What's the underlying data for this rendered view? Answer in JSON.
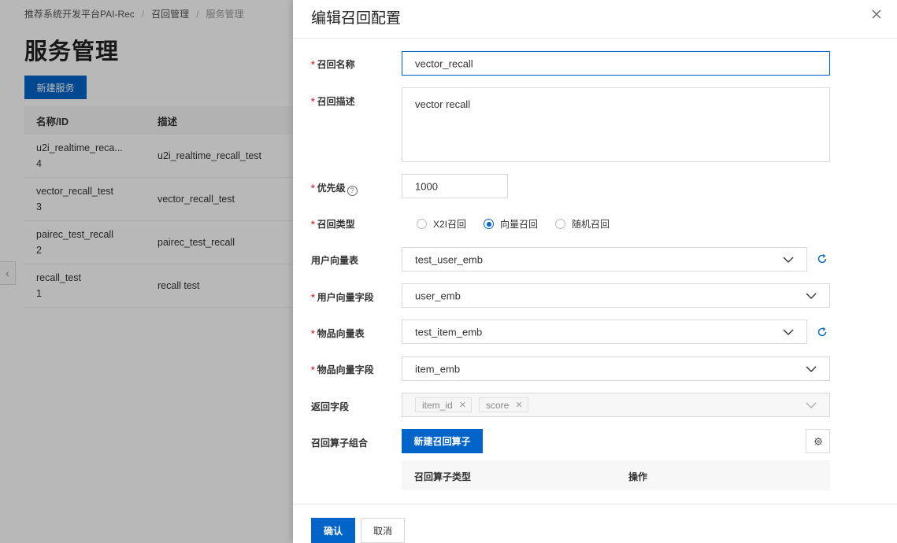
{
  "background": {
    "breadcrumb": [
      "推荐系统开发平台PAI-Rec",
      "召回管理",
      "服务管理"
    ],
    "page_title": "服务管理",
    "new_service_label": "新建服务",
    "table": {
      "headers": [
        "名称/ID",
        "描述"
      ],
      "rows": [
        {
          "name": "u2i_realtime_reca...",
          "id": "4",
          "desc": "u2i_realtime_recall_test"
        },
        {
          "name": "vector_recall_test",
          "id": "3",
          "desc": "vector_recall_test"
        },
        {
          "name": "pairec_test_recall",
          "id": "2",
          "desc": "pairec_test_recall"
        },
        {
          "name": "recall_test",
          "id": "1",
          "desc": "recall test"
        }
      ]
    }
  },
  "drawer": {
    "title": "编辑召回配置",
    "fields": {
      "recall_name": {
        "label": "召回名称",
        "value": "vector_recall"
      },
      "recall_desc": {
        "label": "召回描述",
        "value": "vector recall"
      },
      "priority": {
        "label": "优先级",
        "value": "1000"
      },
      "recall_type": {
        "label": "召回类型",
        "options": [
          "X2I召回",
          "向量召回",
          "随机召回"
        ],
        "selected": "向量召回"
      },
      "user_vector_table": {
        "label": "用户向量表",
        "value": "test_user_emb"
      },
      "user_vector_field": {
        "label": "用户向量字段",
        "value": "user_emb"
      },
      "item_vector_table": {
        "label": "物品向量表",
        "value": "test_item_emb"
      },
      "item_vector_field": {
        "label": "物品向量字段",
        "value": "item_emb"
      },
      "return_fields": {
        "label": "返回字段",
        "tags": [
          "item_id",
          "score"
        ]
      },
      "operator_group": {
        "label": "召回算子组合",
        "button": "新建召回算子",
        "columns": [
          "召回算子类型",
          "操作"
        ]
      }
    },
    "footer": {
      "confirm": "确认",
      "cancel": "取消"
    }
  },
  "colors": {
    "primary": "#0064c8",
    "required": "#e4393c"
  }
}
